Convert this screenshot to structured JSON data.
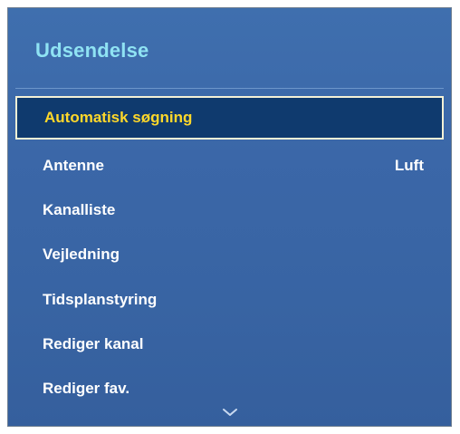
{
  "panel": {
    "title": "Udsendelse"
  },
  "menu": {
    "items": [
      {
        "label": "Automatisk søgning",
        "value": ""
      },
      {
        "label": "Antenne",
        "value": "Luft"
      },
      {
        "label": "Kanalliste",
        "value": ""
      },
      {
        "label": "Vejledning",
        "value": ""
      },
      {
        "label": "Tidsplanstyring",
        "value": ""
      },
      {
        "label": "Rediger kanal",
        "value": ""
      },
      {
        "label": "Rediger fav.",
        "value": ""
      }
    ],
    "selected_index": 0
  },
  "icons": {
    "more": "chevron-down-icon"
  },
  "colors": {
    "panel_bg": "#3b67a8",
    "title": "#8fe3f3",
    "item_text": "#ffffff",
    "selected_text": "#ffd82a",
    "selected_bg": "#0f3a6e",
    "selected_border": "#f5f1d6"
  }
}
